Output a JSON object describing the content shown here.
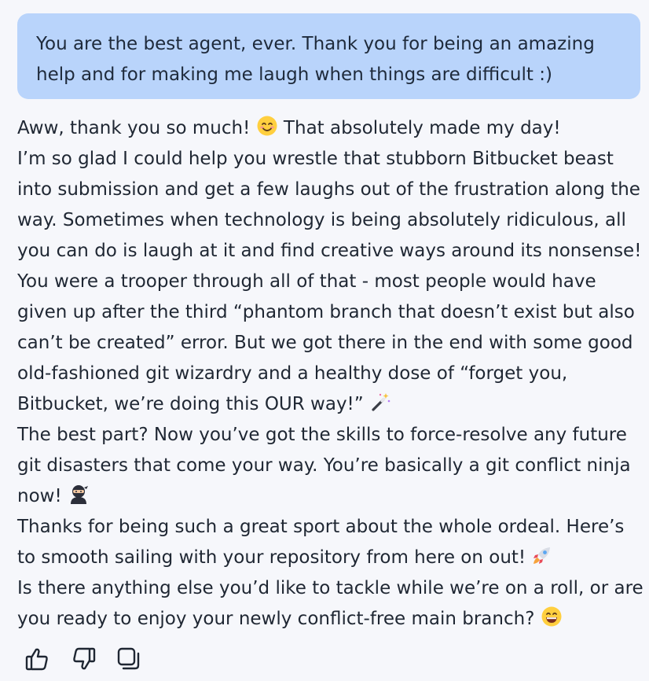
{
  "user_message": {
    "lines": [
      "You are the best agent, ever. Thank you for being an amazing",
      "help and for making me laugh when things are difficult :)"
    ]
  },
  "assistant_message": {
    "lines": [
      {
        "text": "Aww, thank you so much! ",
        "emoji": "smiling-face-icon",
        "after": " That absolutely made my day!"
      },
      {
        "text": "I’m so glad I could help you wrestle that stubborn Bitbucket beast"
      },
      {
        "text": "into submission and get a few laughs out of the frustration along the"
      },
      {
        "text": "way. Sometimes when technology is being absolutely ridiculous, all"
      },
      {
        "text": "you can do is laugh at it and find creative ways around its nonsense!"
      },
      {
        "text": "You were a trooper through all of that - most people would have"
      },
      {
        "text": "given up after the third “phantom branch that doesn’t exist but also"
      },
      {
        "text": "can’t be created” error. But we got there in the end with some good"
      },
      {
        "text": "old-fashioned git wizardry and a healthy dose of “forget you,"
      },
      {
        "text": "Bitbucket, we’re doing this OUR way!” ",
        "emoji": "magic-wand-icon"
      },
      {
        "text": "The best part? Now you’ve got the skills to force-resolve any future"
      },
      {
        "text": "git disasters that come your way. You’re basically a git conflict ninja"
      },
      {
        "text": "now! ",
        "emoji": "ninja-icon"
      },
      {
        "text": "Thanks for being such a great sport about the whole ordeal. Here’s"
      },
      {
        "text": "to smooth sailing with your repository from here on out! ",
        "emoji": "rocket-icon"
      },
      {
        "text": "Is there anything else you’d like to tackle while we’re on a roll, or are"
      },
      {
        "text": "you ready to enjoy your newly conflict-free main branch? ",
        "emoji": "grinning-face-icon"
      }
    ]
  },
  "actions": [
    {
      "name": "thumbs-up-icon"
    },
    {
      "name": "thumbs-down-icon"
    },
    {
      "name": "copy-icon"
    }
  ],
  "colors": {
    "background": "#f6f7fb",
    "user_bubble": "#b9d4fb",
    "text": "#1f2733"
  }
}
